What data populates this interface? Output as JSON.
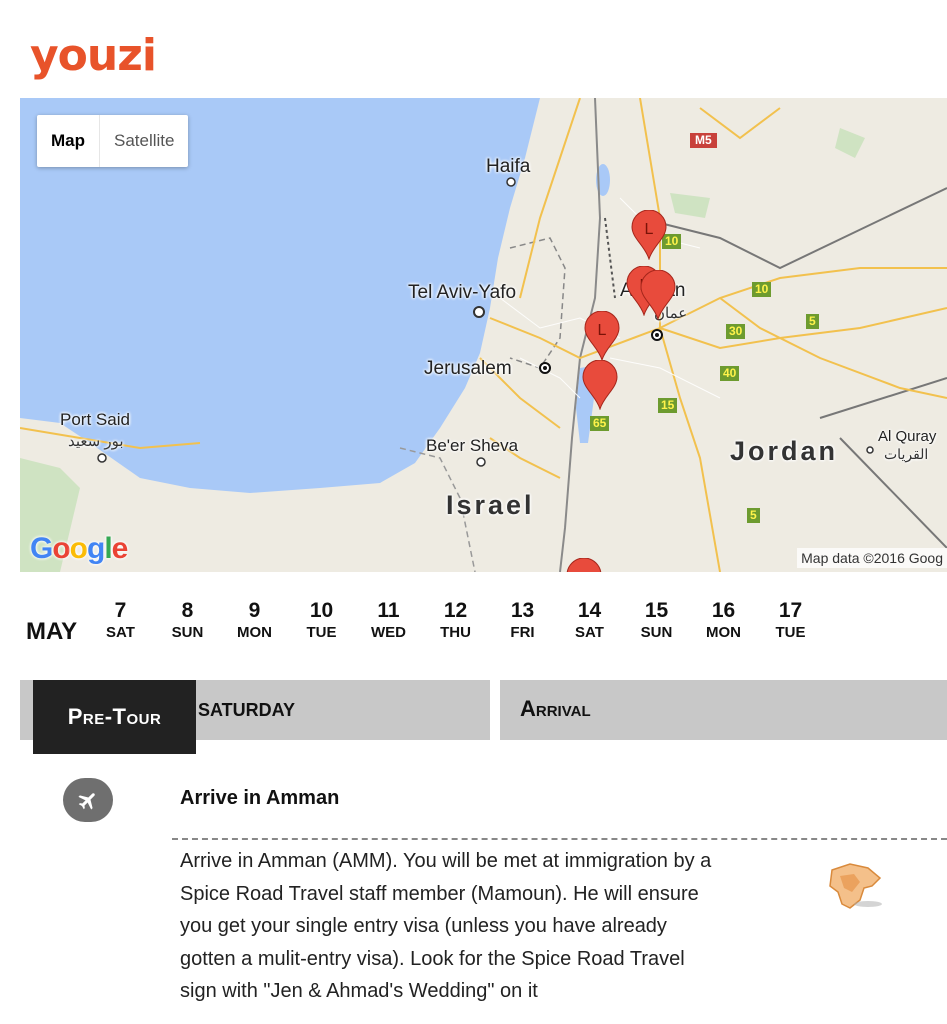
{
  "brand": {
    "logo_text": "youzi",
    "color": "#e8532a"
  },
  "map": {
    "type_controls": {
      "map_label": "Map",
      "satellite_label": "Satellite",
      "active": "Map"
    },
    "places": {
      "haifa": "Haifa",
      "tel_aviv": "Tel Aviv-Yafo",
      "jerusalem": "Jerusalem",
      "port_said": "Port Said",
      "port_said_ar": "بور سعيد",
      "beer_sheva": "Be'er Sheva",
      "israel": "Israel",
      "amman": "Amman",
      "amman_ar": "عمان",
      "jordan": "Jordan",
      "al_quray": "Al Quray",
      "al_quray_ar": "القريات"
    },
    "roads": [
      "M5",
      "10",
      "10",
      "30",
      "5",
      "40",
      "15",
      "65",
      "5"
    ],
    "marker_label": "L",
    "marker_color": "#e84b3c",
    "water_color": "#a9c9f7",
    "google_logo": [
      "G",
      "o",
      "o",
      "g",
      "l",
      "e"
    ],
    "attribution": "Map data ©2016 Goog"
  },
  "calendar": {
    "month": "MAY",
    "days": [
      {
        "num": "7",
        "dow": "SAT"
      },
      {
        "num": "8",
        "dow": "SUN"
      },
      {
        "num": "9",
        "dow": "MON"
      },
      {
        "num": "10",
        "dow": "TUE"
      },
      {
        "num": "11",
        "dow": "WED"
      },
      {
        "num": "12",
        "dow": "THU"
      },
      {
        "num": "13",
        "dow": "FRI"
      },
      {
        "num": "14",
        "dow": "SAT"
      },
      {
        "num": "15",
        "dow": "SUN"
      },
      {
        "num": "16",
        "dow": "MON"
      },
      {
        "num": "17",
        "dow": "TUE"
      }
    ]
  },
  "day_header": {
    "badge": "Pre-Tour",
    "weekday": "SATURDAY",
    "title": "Arrival"
  },
  "itinerary": {
    "icon": "airplane-icon",
    "title": "Arrive in Amman",
    "lines": [
      "Arrive in Amman (AMM). You will be met at immigration by a",
      "Spice Road Travel staff member (Mamoun). He will ensure",
      "you get your single entry visa (unless you have already",
      "gotten a mulit-entry visa). Look for the Spice Road Travel",
      "sign with \"Jen & Ahmad's Wedding\" on it"
    ]
  }
}
